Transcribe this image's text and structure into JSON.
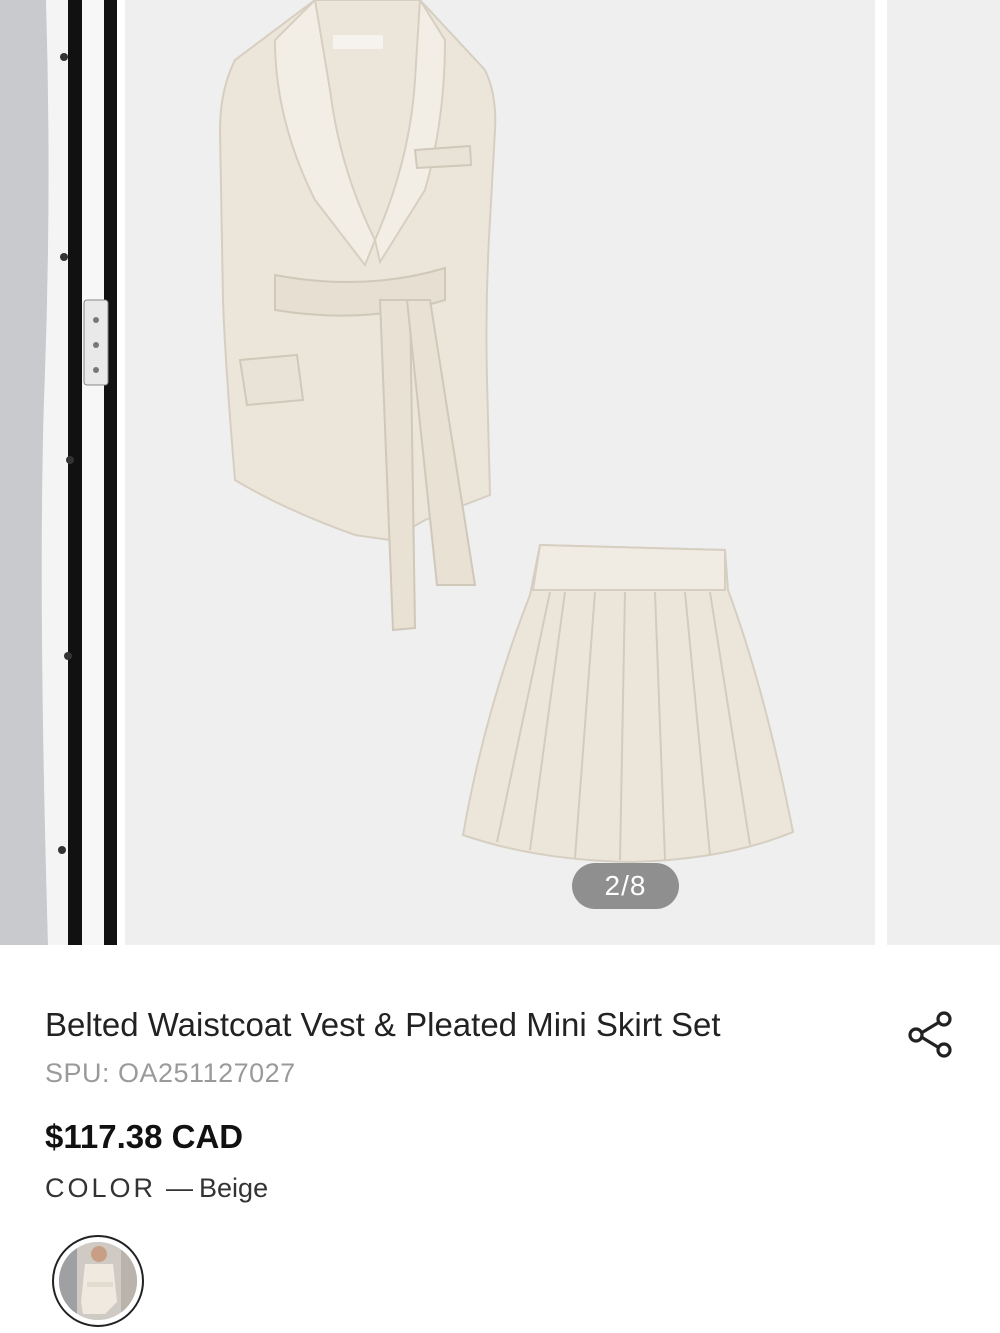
{
  "gallery": {
    "counter": "2/8",
    "current_index": 2,
    "total": 8
  },
  "product": {
    "title": "Belted Waistcoat Vest & Pleated Mini Skirt Set",
    "spu": "SPU: OA251127027",
    "price": "$117.38 CAD",
    "color_label": "COLOR",
    "color_separator": "—",
    "color_value": "Beige"
  },
  "icons": {
    "share": "share-icon"
  },
  "colors": {
    "garment": "#ece6da",
    "image_bg": "#efefef",
    "counter_bg": "#8f8f8f"
  }
}
